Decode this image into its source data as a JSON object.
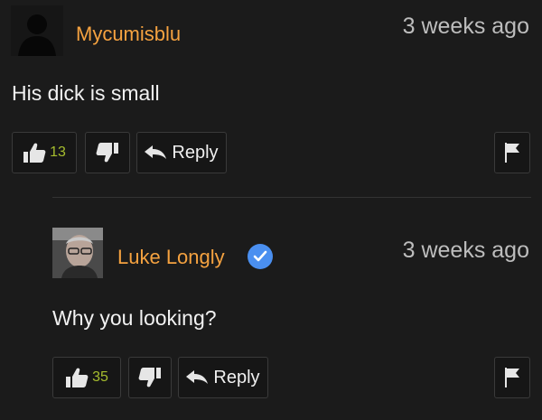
{
  "comments": [
    {
      "username": "Mycumisblu",
      "time": "3 weeks ago",
      "text": "His dick is small",
      "likes": "13",
      "reply_label": "Reply",
      "avatar_icon": "default-user-icon"
    },
    {
      "username": "Luke Longly",
      "time": "3 weeks ago",
      "text": "Why you looking?",
      "likes": "35",
      "reply_label": "Reply",
      "avatar_icon": "user-photo",
      "verified": true
    }
  ],
  "colors": {
    "background": "#1b1b1b",
    "username": "#f5a240",
    "like_count": "#a6bd2e",
    "verified_badge": "#4a8ff0"
  },
  "icons": [
    "thumbs-up-icon",
    "thumbs-down-icon",
    "reply-arrow-icon",
    "flag-icon",
    "verified-check-icon"
  ]
}
